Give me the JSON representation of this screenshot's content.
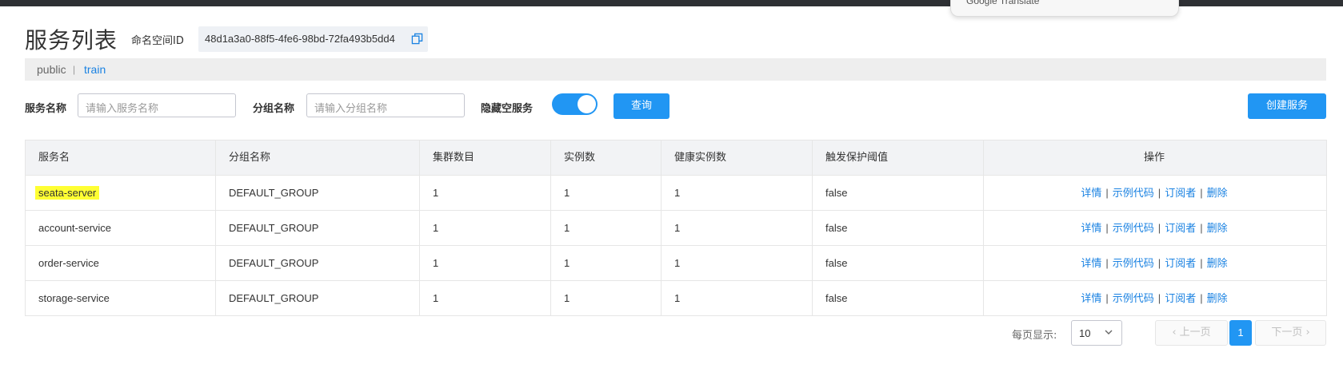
{
  "translate_popup": {
    "label": "Google Translate"
  },
  "page": {
    "title": "服务列表"
  },
  "namespace": {
    "label": "命名空间ID",
    "id": "48d1a3a0-88f5-4fe6-98bd-72fa493b5dd4",
    "items": [
      "public",
      "train"
    ],
    "separator": "|",
    "active": "train"
  },
  "filters": {
    "service_name_label": "服务名称",
    "service_name_placeholder": "请输入服务名称",
    "group_name_label": "分组名称",
    "group_name_placeholder": "请输入分组名称",
    "hide_empty_label": "隐藏空服务",
    "hide_empty_on": true,
    "query_button": "查询",
    "create_button": "创建服务"
  },
  "table": {
    "headers": [
      "服务名",
      "分组名称",
      "集群数目",
      "实例数",
      "健康实例数",
      "触发保护阈值",
      "操作"
    ],
    "rows": [
      {
        "name": "seata-server",
        "group": "DEFAULT_GROUP",
        "clusters": "1",
        "instances": "1",
        "healthy": "1",
        "threshold": "false",
        "highlighted": true
      },
      {
        "name": "account-service",
        "group": "DEFAULT_GROUP",
        "clusters": "1",
        "instances": "1",
        "healthy": "1",
        "threshold": "false"
      },
      {
        "name": "order-service",
        "group": "DEFAULT_GROUP",
        "clusters": "1",
        "instances": "1",
        "healthy": "1",
        "threshold": "false"
      },
      {
        "name": "storage-service",
        "group": "DEFAULT_GROUP",
        "clusters": "1",
        "instances": "1",
        "healthy": "1",
        "threshold": "false"
      }
    ],
    "actions": [
      "详情",
      "示例代码",
      "订阅者",
      "删除"
    ],
    "action_separator": "|"
  },
  "pagination": {
    "per_page_label": "每页显示:",
    "per_page_value": "10",
    "prev_label": "上一页",
    "next_label": "下一页",
    "current_page": "1"
  },
  "colors": {
    "accent": "#2196f3",
    "link": "#1a82e2",
    "highlight": "#ffff33",
    "header_bg": "#f2f3f5"
  }
}
